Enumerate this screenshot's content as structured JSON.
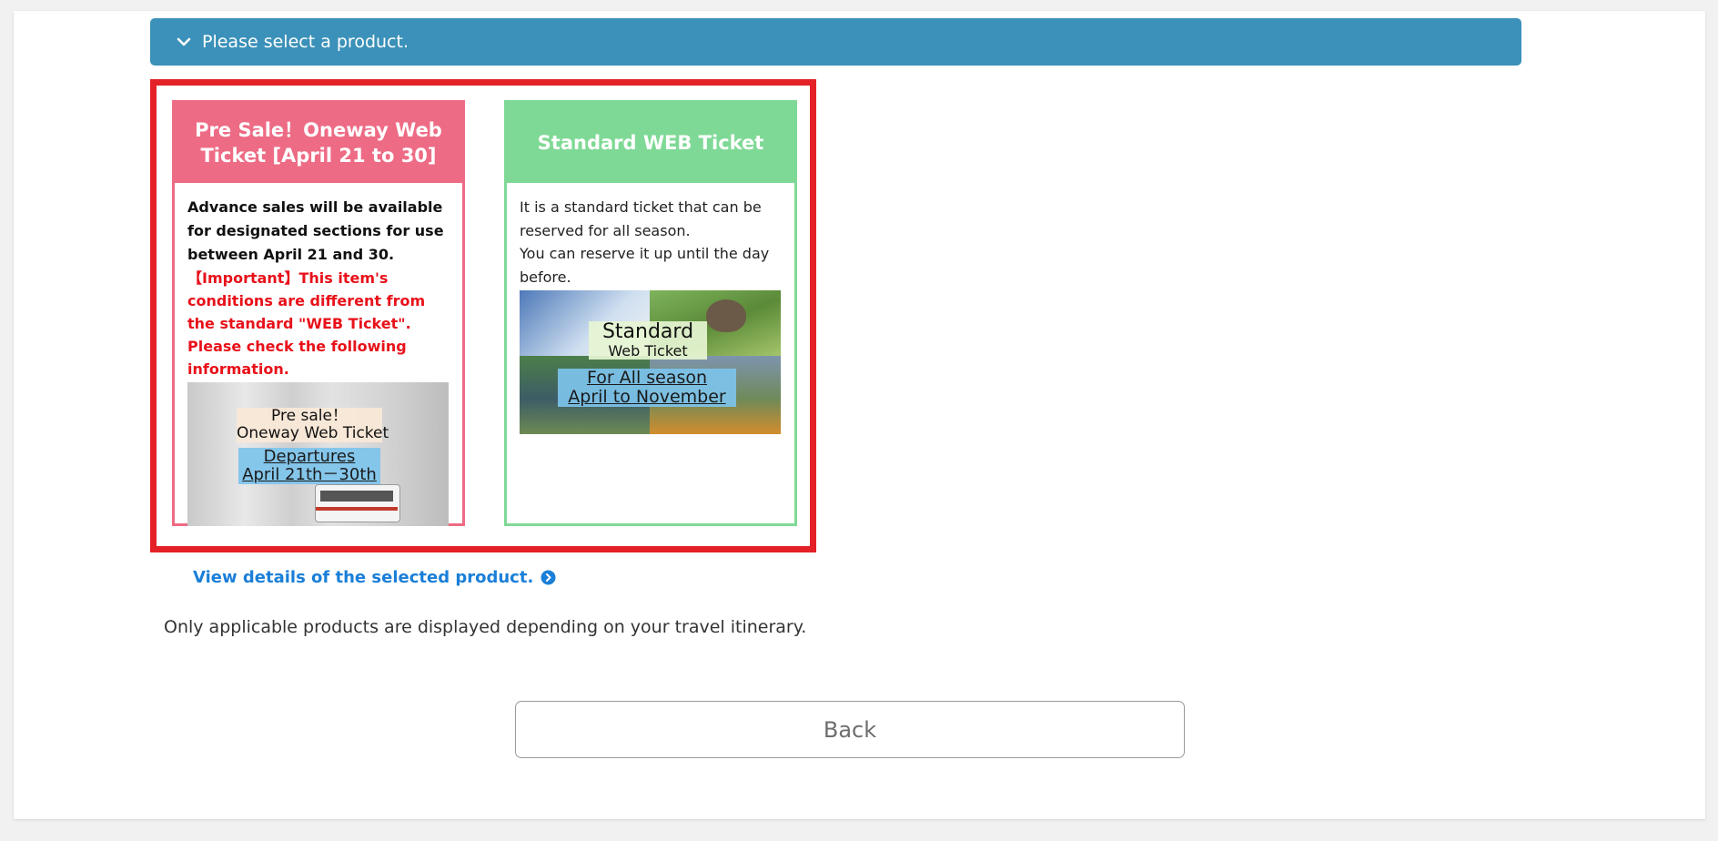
{
  "accordion": {
    "label": "Please select a product.",
    "icon": "chevron-down-icon",
    "background_color": "#3b91b9"
  },
  "selection_highlight_color": "#e32127",
  "products": [
    {
      "title": "Pre Sale！Oneway Web Ticket [April 21 to 30]",
      "header_color": "#ee6b85",
      "description": "Advance sales will be available for designated sections for use between April 21 and 30.",
      "important": "【Important】This item's conditions are different from the standard \"WEB Ticket\". Please check the following information.",
      "image": {
        "line1": "Pre sale！",
        "line2": "Oneway Web Ticket",
        "line3": "Departures",
        "line4": "April 21th－30th"
      }
    },
    {
      "title": "Standard WEB Ticket",
      "header_color": "#7fd996",
      "description_line1": "It is a standard ticket that can be reserved for all season.",
      "description_line2": "You can reserve it up until the day before.",
      "image": {
        "line1": "Standard",
        "line2": "Web Ticket",
        "line3": "For All season",
        "line4": "April to November"
      }
    }
  ],
  "details_link": {
    "label": "View details of the selected product.",
    "icon": "arrow-circle-right-icon",
    "color": "#1a7fd8"
  },
  "note": "Only applicable products are displayed depending on your travel itinerary.",
  "back_button": {
    "label": "Back"
  }
}
